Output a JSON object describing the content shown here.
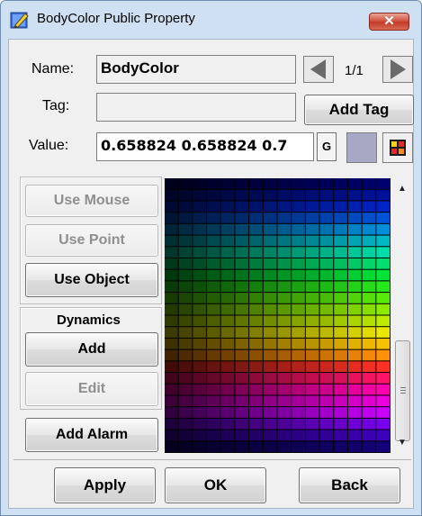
{
  "window": {
    "title": "BodyColor Public Property",
    "close_label": "✕"
  },
  "name_row": {
    "label": "Name:",
    "value": "BodyColor",
    "page": "1/1"
  },
  "tag_row": {
    "label": "Tag:",
    "value": "",
    "add_tag": "Add Tag"
  },
  "value_row": {
    "label": "Value:",
    "value": "0.658824 0.658824 0.7",
    "g_button": "G",
    "swatch_color": "#a8a8c4"
  },
  "left_panel": {
    "use_mouse": "Use Mouse",
    "use_point": "Use Point",
    "use_object": "Use Object",
    "dynamics_heading": "Dynamics",
    "add": "Add",
    "edit": "Edit",
    "add_alarm": "Add Alarm"
  },
  "footer": {
    "apply": "Apply",
    "ok": "OK",
    "back": "Back"
  },
  "icons": {
    "title_icon": "pencil-icon",
    "prev": "arrow-left-icon",
    "next": "arrow-right-icon",
    "color_picker": "color-grid-icon"
  }
}
